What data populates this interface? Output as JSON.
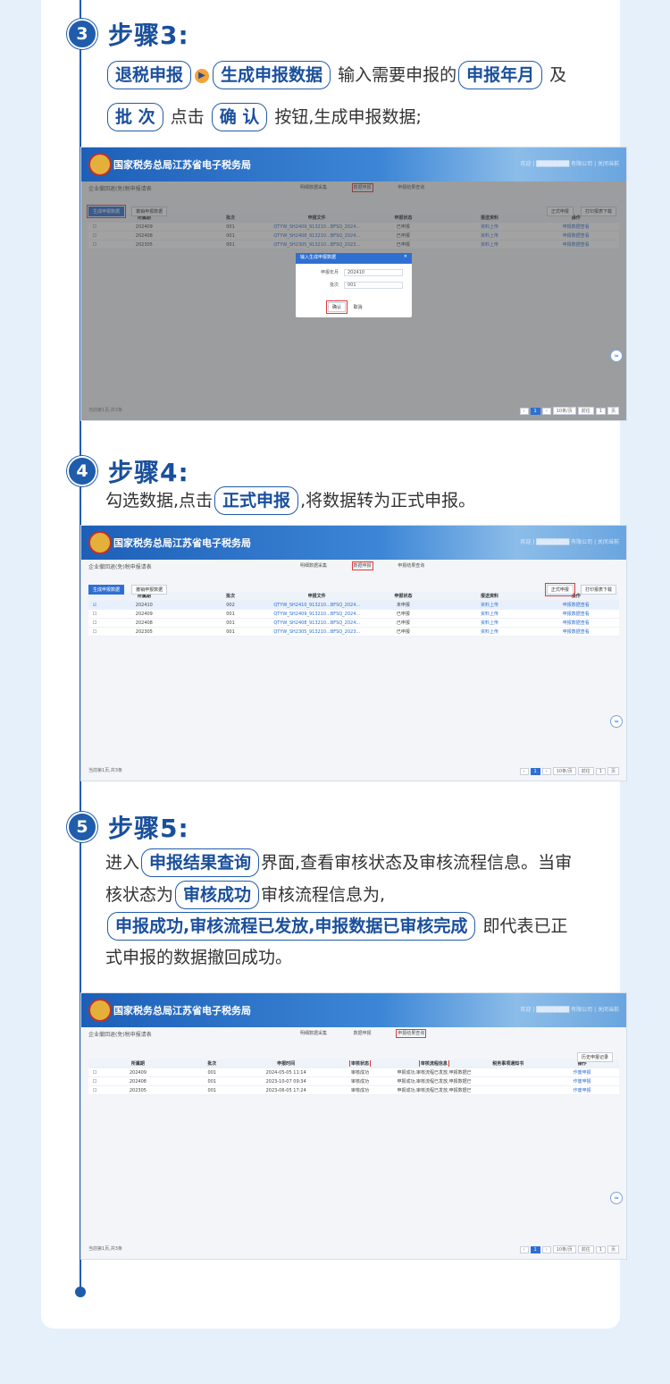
{
  "step3": {
    "num": "3",
    "title": "步骤3:",
    "l1_p1": "退税申报",
    "l1_arrow": "▶",
    "l1_p2": "生成申报数据",
    "l1_t1": "输入需要申报的",
    "l1_p3": "申报年月",
    "l1_t2": "及",
    "l2_p1": "批 次",
    "l2_t1": "点击",
    "l2_p2": "确 认",
    "l2_t2": "按钮,生成申报数据;"
  },
  "step4": {
    "num": "4",
    "title": "步骤4:",
    "t1": "勾选数据,点击",
    "p1": "正式申报",
    "t2": ",将数据转为正式申报。"
  },
  "step5": {
    "num": "5",
    "title": "步骤5:",
    "l1_t1": "进入",
    "l1_p1": "申报结果查询",
    "l1_t2": "界面,查看审核状态及审核流程信息。当审",
    "l2_t1": "核状态为",
    "l2_p1": "审核成功",
    "l2_t2": "审核流程信息为,",
    "l3_p1": "申报成功,审核流程已发放,申报数据已审核完成",
    "l3_t1": "即代表已正",
    "l4": "式申报的数据撤回成功。"
  },
  "shot_common": {
    "banner_title": "国家税务总局江苏省电子税务局",
    "user": "欢迎 | ████████ 有限公司 | 关闭当前",
    "page_title": "企业撤回退(免)税申报请表",
    "flow1": "明细数据采集",
    "flow2": "数据申报",
    "flow3": "申报结果查询",
    "btn_generate": "生成申报数据",
    "btn_withdraw": "撤销申报数据",
    "btn_formal": "正式申报",
    "btn_print": "打印报表下载",
    "btn_history": "历史申报记录",
    "total": "当前第1页,共3条",
    "page_size": "10条/页",
    "goto": "前往",
    "page_num": "1",
    "page_unit": "页"
  },
  "shot1": {
    "headers": [
      "所属期",
      "批次",
      "申报文件",
      "申报状态",
      "报送资料",
      "操作"
    ],
    "rows": [
      [
        "202409",
        "001",
        "QTYW_SH2409_913210...BFSQ_2024...",
        "已申报",
        "资料上传",
        "申报数据查看"
      ],
      [
        "202408",
        "001",
        "QTYW_SH2408_913210...BFSQ_2024...",
        "已申报",
        "资料上传",
        "申报数据查看"
      ],
      [
        "202305",
        "001",
        "QTYW_SH2305_913210...BFSQ_2023...",
        "已申报",
        "资料上传",
        "申报数据查看"
      ]
    ],
    "dialog_title": "输入生成申报数据",
    "dialog_label1": "申报年月",
    "dialog_value1": "202410",
    "dialog_label2": "批次",
    "dialog_value2": "001",
    "dialog_ok": "确认",
    "dialog_cancel": "取消"
  },
  "shot2": {
    "headers": [
      "所属期",
      "批次",
      "申报文件",
      "申报状态",
      "报送资料",
      "操作"
    ],
    "rows": [
      [
        "202410",
        "002",
        "QTYW_SH2410_913210...BFSQ_2024...",
        "未申报",
        "资料上传",
        "申报数据查看"
      ],
      [
        "202409",
        "001",
        "QTYW_SH2409_913210...BFSQ_2024...",
        "已申报",
        "资料上传",
        "申报数据查看"
      ],
      [
        "202408",
        "001",
        "QTYW_SH2408_913210...BFSQ_2024...",
        "已申报",
        "资料上传",
        "申报数据查看"
      ],
      [
        "202305",
        "001",
        "QTYW_SH2305_913210...BFSQ_2023...",
        "已申报",
        "资料上传",
        "申报数据查看"
      ]
    ]
  },
  "shot3": {
    "headers": [
      "所属期",
      "批次",
      "申报时间",
      "审核状态",
      "审核流程信息",
      "税务事项通知书",
      "操作"
    ],
    "rows": [
      [
        "202409",
        "001",
        "2024-05-05 11:14",
        "审核成功",
        "申报成功,审核流程已发放,申报数据已...",
        "",
        "作废申报"
      ],
      [
        "202408",
        "001",
        "2023-10-07 09:34",
        "审核成功",
        "申报成功,审核流程已发放,申报数据已...",
        "",
        "作废申报"
      ],
      [
        "202305",
        "001",
        "2023-06-05 17:24",
        "审核成功",
        "申报成功,审核流程已发放,申报数据已...",
        "",
        "作废申报"
      ]
    ]
  }
}
